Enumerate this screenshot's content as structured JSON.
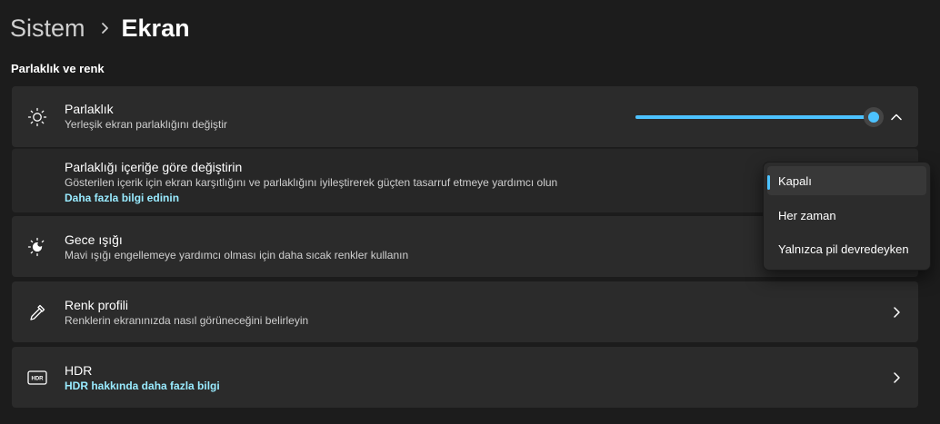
{
  "breadcrumb": {
    "parent": "Sistem",
    "current": "Ekran"
  },
  "section": {
    "title": "Parlaklık ve renk"
  },
  "brightness": {
    "title": "Parlaklık",
    "subtitle": "Yerleşik ekran parlaklığını değiştir",
    "level_percent": 100,
    "icon": "sun-icon"
  },
  "content_brightness": {
    "title": "Parlaklığı içeriğe göre değiştirin",
    "subtitle": "Gösterilen içerik için ekran karşıtlığını ve parlaklığını iyileştirerek güçten tasarruf etmeye yardımcı olun",
    "link": "Daha fazla bilgi edinin"
  },
  "dropdown": {
    "options": [
      "Kapalı",
      "Her zaman",
      "Yalnızca pil devredeyken"
    ],
    "selected": "Kapalı"
  },
  "night_light": {
    "title": "Gece ışığı",
    "subtitle": "Mavi ışığı engellemeye yardımcı olması için daha sıcak renkler kullanın",
    "icon": "night-light-icon"
  },
  "color_profile": {
    "title": "Renk profili",
    "subtitle": "Renklerin ekranınızda nasıl görüneceğini belirleyin",
    "icon": "eyedropper-icon"
  },
  "hdr": {
    "title": "HDR",
    "link": "HDR hakkında daha fazla bilgi",
    "icon": "hdr-icon"
  },
  "colors": {
    "accent": "#4cc2ff",
    "link": "#99ebff",
    "card": "#2b2b2b",
    "background": "#1c1c1c"
  }
}
